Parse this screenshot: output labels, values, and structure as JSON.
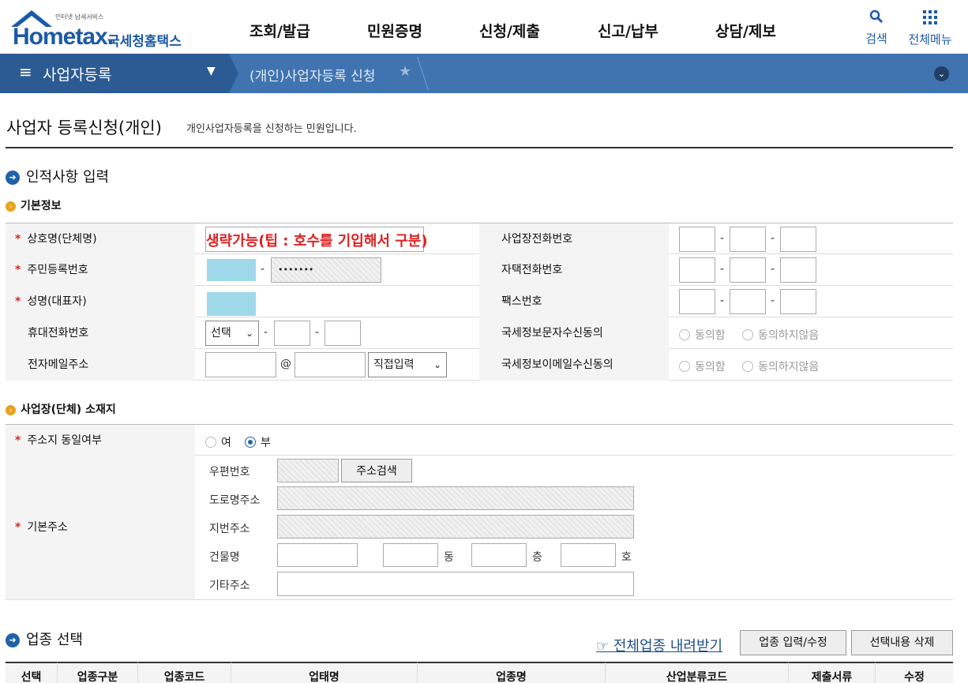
{
  "header": {
    "logo_small": "인터넷 납세서비스",
    "logo_main": "Hometax.",
    "logo_sub": "국세청홈택스",
    "menu": [
      "조회/발급",
      "민원증명",
      "신청/제출",
      "신고/납부",
      "상담/제보"
    ],
    "search_label": "검색",
    "allmenu_label": "전체메뉴"
  },
  "nav": {
    "section": "사업자등록",
    "breadcrumb": "(개인)사업자등록 신청"
  },
  "page": {
    "title": "사업자 등록신청(개인)",
    "desc": "개인사업자등록을 신청하는 민원입니다."
  },
  "identity": {
    "heading": "인적사항 입력",
    "basic_heading": "기본정보",
    "labels": {
      "company": "상호명(단체명)",
      "rrn": "주민등록번호",
      "name": "성명(대표자)",
      "mobile": "휴대전화번호",
      "email": "전자메일주소",
      "biz_phone": "사업장전화번호",
      "home_phone": "자택전화번호",
      "fax": "팩스번호",
      "sms_consent": "국세정보문자수신동의",
      "email_consent": "국세정보이메일수신동의"
    },
    "company_note": "생략가능(팁 : 호수를 기입해서 구분)",
    "rrn_masked": "•••••••",
    "mobile_select": "선택",
    "email_at": "@",
    "email_domain_select": "직접입력",
    "agree": "동의함",
    "disagree": "동의하지않음"
  },
  "address": {
    "heading": "사업장(단체) 소재지",
    "same_label": "주소지 동일여부",
    "yes": "여",
    "no": "부",
    "base_label": "기본주소",
    "zip_label": "우편번호",
    "search_btn": "주소검색",
    "road_label": "도로명주소",
    "jibun_label": "지번주소",
    "building_label": "건물명",
    "dong": "동",
    "floor": "층",
    "ho": "호",
    "etc_label": "기타주소"
  },
  "industry": {
    "heading": "업종 선택",
    "download_link": "☞ 전체업종 내려받기",
    "edit_btn": "업종 입력/수정",
    "delete_btn": "선택내용 삭제",
    "columns": [
      "선택",
      "업종구분",
      "업종코드",
      "업태명",
      "업종명",
      "산업분류코드",
      "제출서류",
      "수정"
    ]
  },
  "colors": {
    "brand": "#1c5aa6",
    "nav": "#3f74b0",
    "required": "#d22222"
  }
}
